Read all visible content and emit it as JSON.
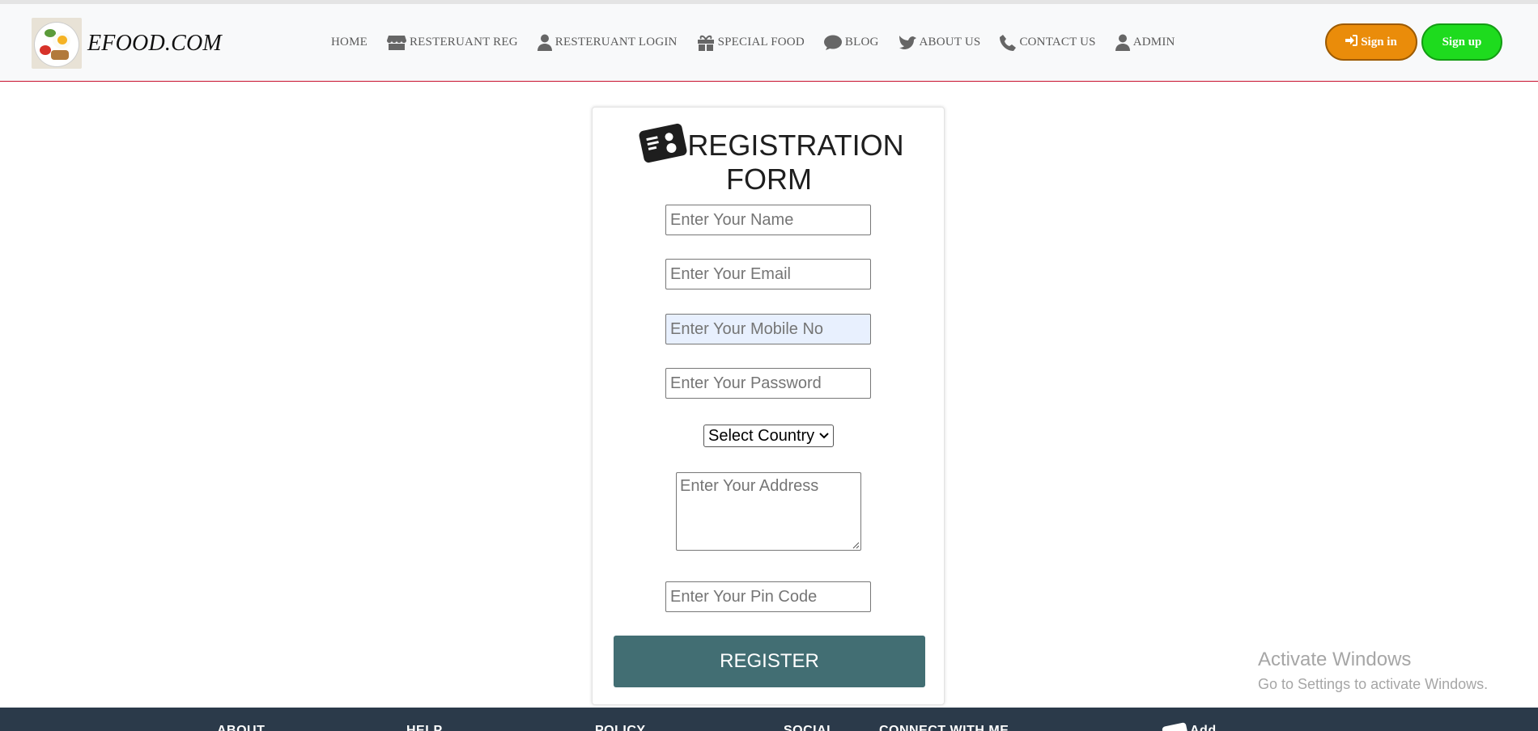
{
  "brand": {
    "name": "EFOOD.COM"
  },
  "nav": {
    "items": [
      {
        "label": "HOME",
        "icon": ""
      },
      {
        "label": "RESTERUANT REG",
        "icon": "store-icon"
      },
      {
        "label": "RESTERUANT LOGIN",
        "icon": "user-icon"
      },
      {
        "label": "SPECIAL FOOD",
        "icon": "gift-icon"
      },
      {
        "label": "BLOG",
        "icon": "comment-icon"
      },
      {
        "label": "ABOUT US",
        "icon": "dove-icon"
      },
      {
        "label": "CONTACT US",
        "icon": "phone-icon"
      },
      {
        "label": "ADMIN",
        "icon": "user-icon"
      }
    ],
    "signin_label": "Sign in",
    "signup_label": "Sign up"
  },
  "form": {
    "title_line1": "REGISTRATION",
    "title_line2": "FORM",
    "name_placeholder": "Enter Your Name",
    "email_placeholder": "Enter Your Email",
    "mobile_placeholder": "Enter Your Mobile No",
    "password_placeholder": "Enter Your Password",
    "country_selected": "Select Country",
    "address_placeholder": "Enter Your Address",
    "pincode_placeholder": "Enter Your Pin Code",
    "register_label": "REGISTER"
  },
  "watermark": {
    "title": "Activate Windows",
    "subtitle": "Go to Settings to activate Windows."
  },
  "footer": {
    "columns": [
      "ABOUT",
      "HELP",
      "POLICY",
      "SOCIAL",
      "CONNECT WITH ME"
    ],
    "brand_partial": "Add"
  },
  "colors": {
    "signin": "#ea8c0a",
    "signup": "#1edb1e",
    "register": "#426e73",
    "footer": "#2b3a4a",
    "nav_border": "#c8102e"
  }
}
